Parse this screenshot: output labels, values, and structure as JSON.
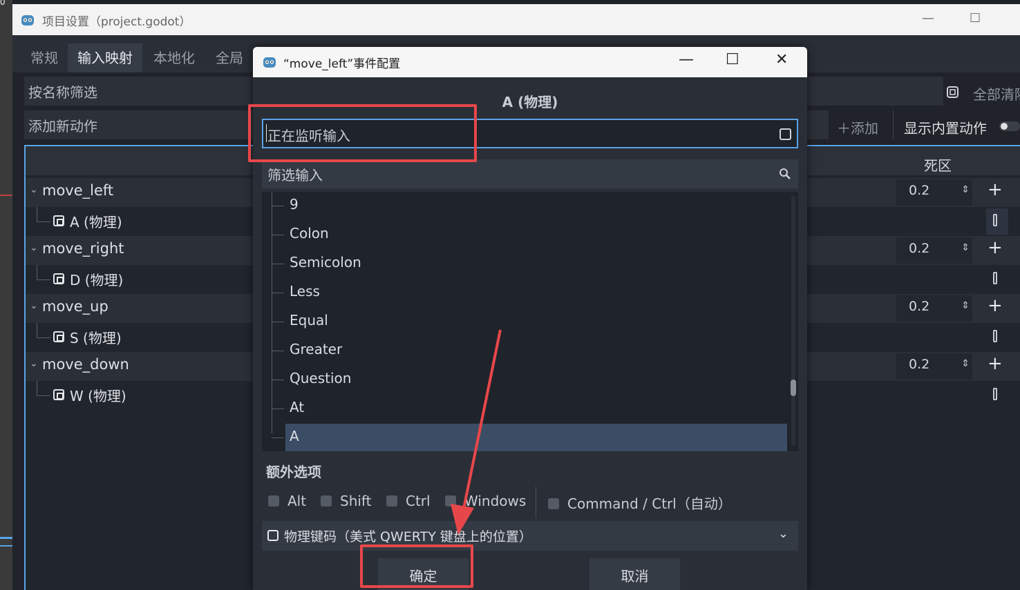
{
  "left_strip": {
    "digit": "0"
  },
  "main_window": {
    "title": "项目设置（project.godot）",
    "controls": {
      "minimize": "—",
      "maximize": "☐"
    },
    "tabs": [
      {
        "label": "常规",
        "active": false
      },
      {
        "label": "输入映射",
        "active": true
      },
      {
        "label": "本地化",
        "active": false
      },
      {
        "label": "全局",
        "active": false
      }
    ],
    "filter_placeholder": "按名称筛选",
    "add_action_placeholder": "添加新动作",
    "add_button": "＋添加",
    "clear_all_label": "全部清除",
    "show_builtin_label": "显示内置动作",
    "deadzone_header": "死区",
    "actions": [
      {
        "name": "move_left",
        "deadzone": "0.2",
        "event": "A (物理)"
      },
      {
        "name": "move_right",
        "deadzone": "0.2",
        "event": "D (物理)"
      },
      {
        "name": "move_up",
        "deadzone": "0.2",
        "event": "S (物理)"
      },
      {
        "name": "move_down",
        "deadzone": "0.2",
        "event": "W (物理)"
      }
    ]
  },
  "dialog": {
    "title": "“move_left”事件配置",
    "controls": {
      "minimize": "—",
      "maximize": "☐",
      "close": "✕"
    },
    "heading": "A (物理)",
    "listen_text": "正在监听输入",
    "filter_placeholder": "筛选输入",
    "keys": [
      {
        "label": "9",
        "selected": false
      },
      {
        "label": "Colon",
        "selected": false
      },
      {
        "label": "Semicolon",
        "selected": false
      },
      {
        "label": "Less",
        "selected": false
      },
      {
        "label": "Equal",
        "selected": false
      },
      {
        "label": "Greater",
        "selected": false
      },
      {
        "label": "Question",
        "selected": false
      },
      {
        "label": "At",
        "selected": false
      },
      {
        "label": "A",
        "selected": true
      }
    ],
    "extra_options_label": "额外选项",
    "modifiers": [
      "Alt",
      "Shift",
      "Ctrl",
      "Windows",
      "Command / Ctrl（自动）"
    ],
    "physical_select": "物理键码（美式 QWERTY 键盘上的位置）",
    "ok_button": "确定",
    "cancel_button": "取消"
  },
  "colors": {
    "accent_blue": "#5aa4e8",
    "annotation_red": "#e8474a",
    "selected_row": "#3b4d64"
  }
}
